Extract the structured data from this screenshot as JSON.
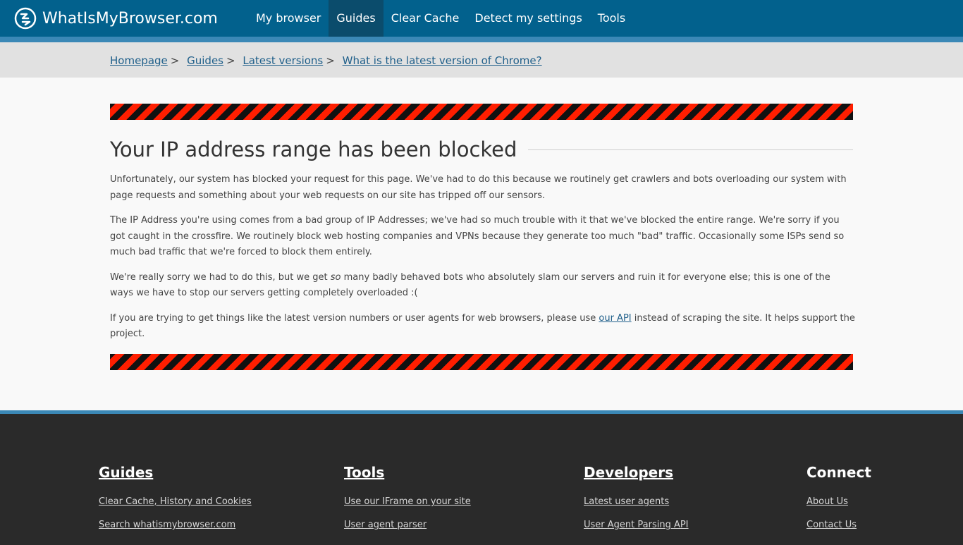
{
  "header": {
    "logo_text": "WhatIsMyBrowser.com",
    "nav": [
      {
        "label": "My browser"
      },
      {
        "label": "Guides"
      },
      {
        "label": "Clear Cache"
      },
      {
        "label": "Detect my settings"
      },
      {
        "label": "Tools"
      }
    ],
    "active_nav": "Guides"
  },
  "breadcrumb": [
    {
      "label": "Homepage"
    },
    {
      "label": "Guides"
    },
    {
      "label": "Latest versions"
    },
    {
      "label": "What is the latest version of Chrome?"
    }
  ],
  "breadcrumb_separator": ">",
  "main": {
    "title": "Your IP address range has been blocked",
    "para1": "Unfortunately, our system has blocked your request for this page. We've had to do this because we routinely get crawlers and bots overloading our system with page requests and something about your web requests on our site has tripped off our sensors.",
    "para2": "The IP Address you're using comes from a bad group of IP Addresses; we've had so much trouble with it that we've blocked the entire range. We're sorry if you got caught in the crossfire. We routinely block web hosting companies and VPNs because they generate too much \"bad\" traffic. Occasionally some ISPs send so much bad traffic that we're forced to block them entirely.",
    "para3_a": "We're really sorry we had to do this, but we get ",
    "para3_em": "so",
    "para3_b": " many badly behaved bots who absolutely slam our servers and ruin it for everyone else; this is one of the ways we have to stop our servers getting completely overloaded :(",
    "para4_a": "If you are trying to get things like the latest version numbers or user agents for web browsers, please use ",
    "para4_link": "our API",
    "para4_b": " instead of scraping the site. It helps support the project."
  },
  "footer": {
    "guides": {
      "title": "Guides",
      "links": [
        "Clear Cache, History and Cookies",
        "Search whatismybrowser.com"
      ]
    },
    "tools": {
      "title": "Tools",
      "links": [
        "Use our IFrame on your site",
        "User agent parser"
      ]
    },
    "developers": {
      "title": "Developers",
      "links": [
        "Latest user agents",
        "User Agent Parsing API"
      ]
    },
    "connect": {
      "title": "Connect",
      "links": [
        "About Us",
        "Contact Us"
      ]
    }
  },
  "colors": {
    "header_bg": "#02618d",
    "accent": "#3b88b6",
    "breadcrumb_bg": "#e1e1e1",
    "warning_red": "#ff1e00",
    "warning_black": "#111111",
    "footer_bg": "#2a2a2a",
    "link": "#1f5f8a"
  },
  "icons": {
    "logo": "browser-logo-icon"
  }
}
